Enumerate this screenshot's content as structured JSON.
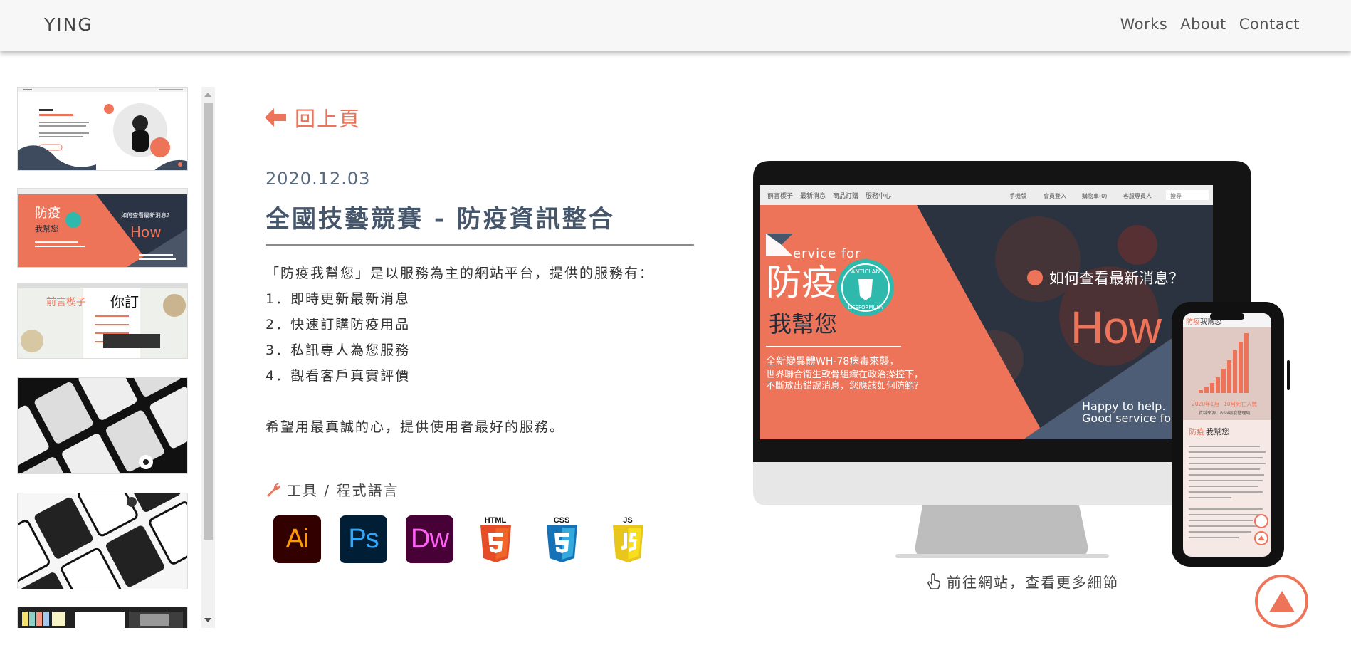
{
  "nav": {
    "brand": "YING",
    "links": [
      "Works",
      "About",
      "Contact"
    ]
  },
  "back_label": "回上頁",
  "project": {
    "date": "2020.12.03",
    "title": "全國技藝競賽 - 防疫資訊整合",
    "intro": "「防疫我幫您」是以服務為主的網站平台，提供的服務有：",
    "features": [
      "1．即時更新最新消息",
      "2．快速訂購防疫用品",
      "3．私訊專人為您服務",
      "4．觀看客戶真實評價"
    ],
    "closing": "希望用最真誠的心，提供使用者最好的服務。"
  },
  "tools": {
    "label": "工具 / 程式語言",
    "items": [
      {
        "name": "Ai",
        "icon": "illustrator-icon",
        "bg": "#330000",
        "fg": "#ff9a00"
      },
      {
        "name": "Ps",
        "icon": "photoshop-icon",
        "bg": "#001e36",
        "fg": "#31a8ff"
      },
      {
        "name": "Dw",
        "icon": "dreamweaver-icon",
        "bg": "#470137",
        "fg": "#ff61f6"
      },
      {
        "name": "HTML",
        "icon": "html5-icon",
        "color": "#e44d26"
      },
      {
        "name": "CSS",
        "icon": "css3-icon",
        "color": "#1572b6"
      },
      {
        "name": "JS",
        "icon": "js-icon",
        "color": "#f0db4f"
      }
    ]
  },
  "mockup": {
    "site_nav": [
      "前言楔子",
      "最新消息",
      "商品訂購",
      "服務中心"
    ],
    "site_nav_right": [
      "手機版",
      "會員登入",
      "購物車(0)",
      "客服專員人",
      "搜尋"
    ],
    "banner_service": "ervice for",
    "banner_main": "防疫",
    "banner_sub": "我幫您",
    "badge_top": "ANTICLAN",
    "badge_bottom": "LIFEFORMULA",
    "banner_text": [
      "全新變異體WH-78病毒來襲，",
      "世界聯合衛生軟骨組織在政治操控下，",
      "不斷放出錯誤消息，您應該如何防範？"
    ],
    "banner_question": "如何查看最新消息？",
    "banner_how": "How",
    "banner_happy": [
      "Happy to help.",
      "Good service fo"
    ],
    "phone_title_accent": "防疫",
    "phone_title": "我幫您",
    "phone_chart_caption": "2020年1月~10月死亡人數",
    "phone_chart_source": "資料來源：BSN病疫管理局",
    "phone_heading_accent": "防疫",
    "phone_heading": "我幫您"
  },
  "visit_label": "前往網站，查看更多細節",
  "colors": {
    "accent": "#ee7459",
    "slate": "#46566b",
    "dark": "#252d3b"
  }
}
